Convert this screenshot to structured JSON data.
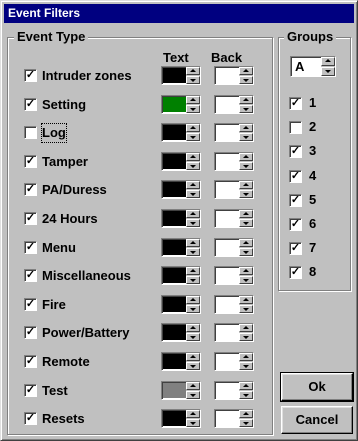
{
  "window": {
    "title": "Event Filters"
  },
  "event_type": {
    "title": "Event Type",
    "text_header": "Text",
    "back_header": "Back",
    "items": [
      {
        "label": "Intruder zones",
        "checked": true,
        "text_color": "#000000",
        "back_color": "#ffffff"
      },
      {
        "label": "Setting",
        "checked": true,
        "text_color": "#008000",
        "back_color": "#ffffff"
      },
      {
        "label": "Log",
        "checked": false,
        "text_color": "#000000",
        "back_color": "#ffffff"
      },
      {
        "label": "Tamper",
        "checked": true,
        "text_color": "#000000",
        "back_color": "#ffffff"
      },
      {
        "label": "PA/Duress",
        "checked": true,
        "text_color": "#000000",
        "back_color": "#ffffff"
      },
      {
        "label": "24 Hours",
        "checked": true,
        "text_color": "#000000",
        "back_color": "#ffffff"
      },
      {
        "label": "Menu",
        "checked": true,
        "text_color": "#000000",
        "back_color": "#ffffff"
      },
      {
        "label": "Miscellaneous",
        "checked": true,
        "text_color": "#000000",
        "back_color": "#ffffff"
      },
      {
        "label": "Fire",
        "checked": true,
        "text_color": "#000000",
        "back_color": "#ffffff"
      },
      {
        "label": "Power/Battery",
        "checked": true,
        "text_color": "#000000",
        "back_color": "#ffffff"
      },
      {
        "label": "Remote",
        "checked": true,
        "text_color": "#000000",
        "back_color": "#ffffff"
      },
      {
        "label": "Test",
        "checked": true,
        "text_color": "#808080",
        "back_color": "#ffffff"
      },
      {
        "label": "Resets",
        "checked": true,
        "text_color": "#000000",
        "back_color": "#ffffff"
      }
    ]
  },
  "groups": {
    "title": "Groups",
    "selector_value": "A",
    "items": [
      {
        "label": "1",
        "checked": true
      },
      {
        "label": "2",
        "checked": false
      },
      {
        "label": "3",
        "checked": true
      },
      {
        "label": "4",
        "checked": true
      },
      {
        "label": "5",
        "checked": true
      },
      {
        "label": "6",
        "checked": true
      },
      {
        "label": "7",
        "checked": true
      },
      {
        "label": "8",
        "checked": true
      }
    ]
  },
  "buttons": {
    "ok": "Ok",
    "cancel": "Cancel"
  },
  "colors": {
    "title_bar": "#000080",
    "face": "#c0c0c0"
  },
  "icons": {
    "checkmark": "check-mark-icon",
    "spin_up": "arrow-up-icon",
    "spin_down": "arrow-down-icon"
  }
}
